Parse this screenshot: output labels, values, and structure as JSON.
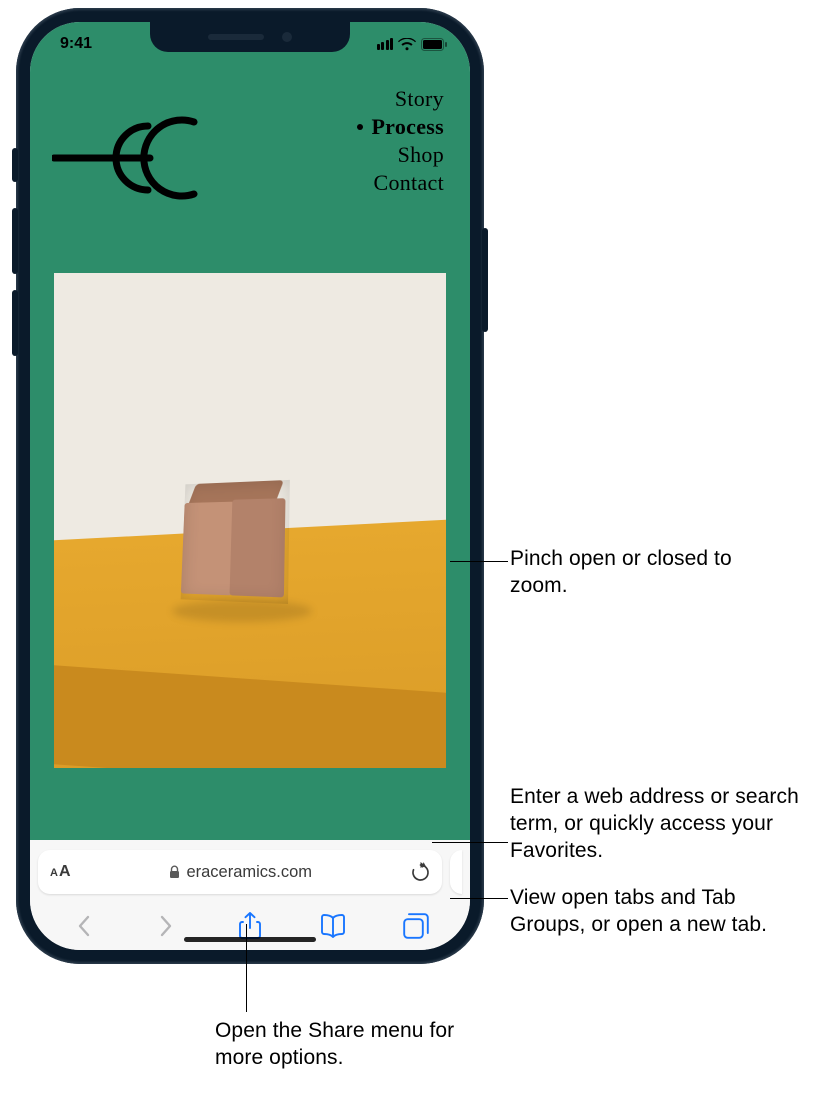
{
  "status_bar": {
    "time": "9:41"
  },
  "site": {
    "nav": {
      "item0": "Story",
      "item1": "Process",
      "item2": "Shop",
      "item3": "Contact"
    }
  },
  "address_bar": {
    "domain": "eraceramics.com"
  },
  "callouts": {
    "zoom": "Pinch open or closed to zoom.",
    "address": "Enter a web address or search term, or quickly access your Favorites.",
    "tabs": "View open tabs and Tab Groups, or open a new tab.",
    "share": "Open the Share menu for more options."
  }
}
